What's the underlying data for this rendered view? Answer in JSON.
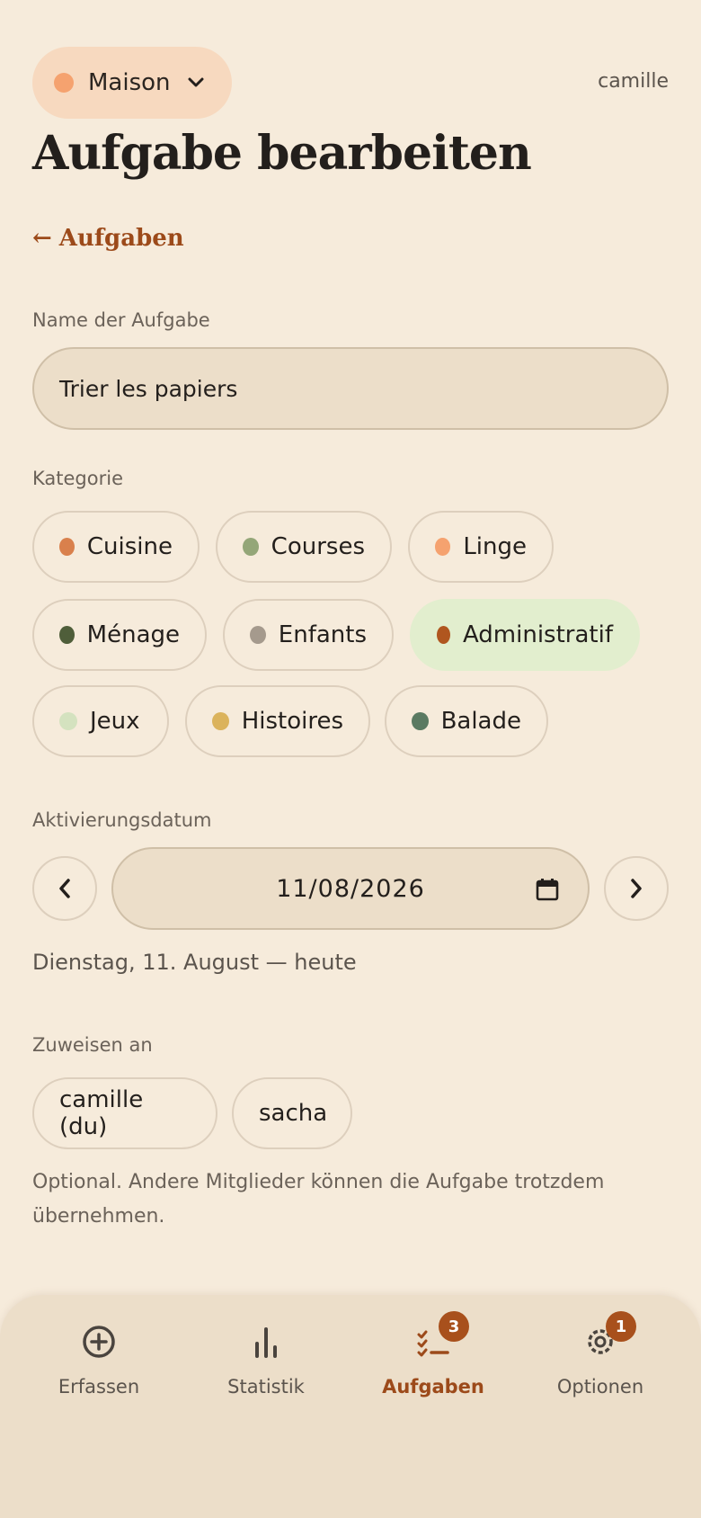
{
  "header": {
    "household": {
      "name": "Maison",
      "color": "#f5a26f"
    },
    "user": "camille",
    "title": "Aufgabe bearbeiten",
    "back_arrow": "←",
    "back_label": "Aufgaben"
  },
  "form": {
    "name_label": "Name der Aufgabe",
    "name_value": "Trier les papiers",
    "category_label": "Kategorie",
    "categories": [
      {
        "label": "Cuisine",
        "color": "#d9804c",
        "selected": false
      },
      {
        "label": "Courses",
        "color": "#94a678",
        "selected": false
      },
      {
        "label": "Linge",
        "color": "#f5a26f",
        "selected": false
      },
      {
        "label": "Ménage",
        "color": "#4f5e3a",
        "selected": false
      },
      {
        "label": "Enfants",
        "color": "#a59a8d",
        "selected": false
      },
      {
        "label": "Administratif",
        "color": "#b0561f",
        "selected": true
      },
      {
        "label": "Jeux",
        "color": "#d4e2bf",
        "selected": false
      },
      {
        "label": "Histoires",
        "color": "#dbb35c",
        "selected": false
      },
      {
        "label": "Balade",
        "color": "#5b7a62",
        "selected": false
      }
    ],
    "date_label": "Aktivierungsdatum",
    "date_value": "11/08/2026",
    "date_description": "Dienstag, 11. August — heute",
    "assign_label": "Zuweisen an",
    "assignees": [
      {
        "label": "camille (du)"
      },
      {
        "label": "sacha"
      }
    ],
    "assign_hint": "Optional. Andere Mitglieder können die Aufgabe trotzdem übernehmen."
  },
  "nav": {
    "items": [
      {
        "label": "Erfassen",
        "icon": "plus-circle-icon",
        "badge": ""
      },
      {
        "label": "Statistik",
        "icon": "bar-chart-icon",
        "badge": ""
      },
      {
        "label": "Aufgaben",
        "icon": "checklist-icon",
        "badge": "3",
        "active": true
      },
      {
        "label": "Optionen",
        "icon": "settings-gear-icon",
        "badge": "1"
      }
    ]
  }
}
